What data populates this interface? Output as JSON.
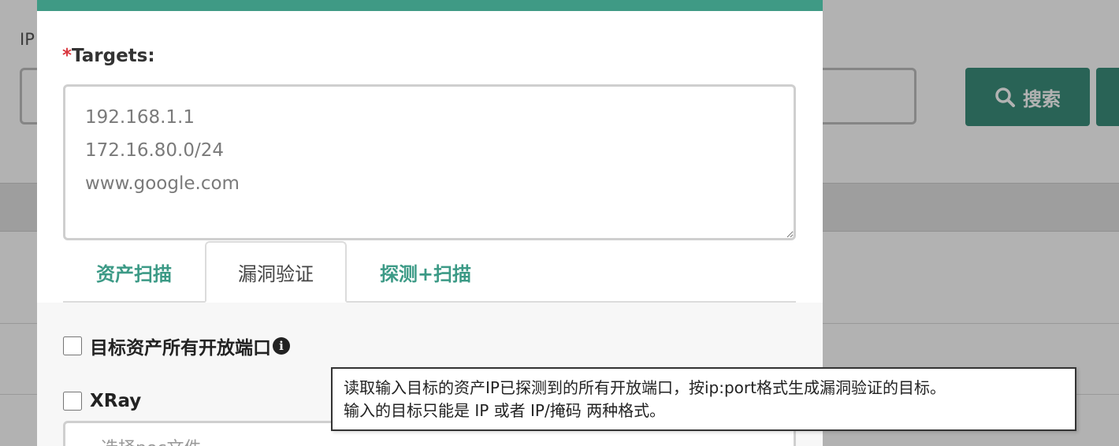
{
  "background": {
    "filter_label": "IP",
    "search_button_label": "搜索"
  },
  "modal": {
    "targets": {
      "required_mark": "*",
      "label": "Targets:",
      "placeholder": "192.168.1.1\n172.16.80.0/24\nwww.google.com"
    },
    "tabs": [
      {
        "label": "资产扫描",
        "active": false
      },
      {
        "label": "漏洞验证",
        "active": true
      },
      {
        "label": "探测+扫描",
        "active": false
      }
    ],
    "options": {
      "all_open_ports_label": "目标资产所有开放端口",
      "xray_label": "XRay",
      "poc_file_placeholder": "选择poc文件"
    },
    "tooltip": {
      "line1": "读取输入目标的资产IP已探测到的所有开放端口，按ip:port格式生成漏洞验证的目标。",
      "line2": "输入的目标只能是 IP 或者 IP/掩码 两种格式。"
    }
  },
  "colors": {
    "accent": "#3f9a85",
    "required": "#d9363e"
  },
  "icons": {
    "search": "search-icon",
    "info": "info-icon",
    "resize": "resize-handle-icon"
  }
}
